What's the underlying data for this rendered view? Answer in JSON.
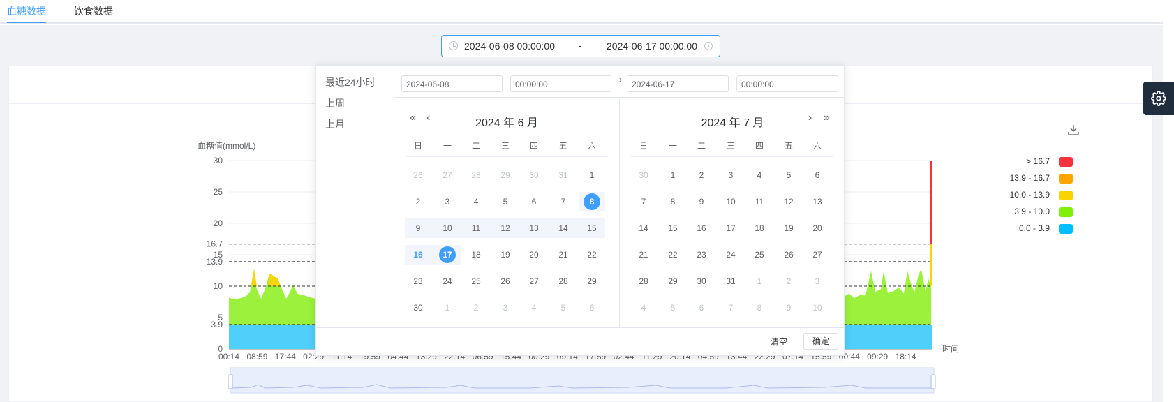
{
  "tabs": [
    {
      "label": "血糖数据",
      "active": true
    },
    {
      "label": "饮食数据",
      "active": false
    }
  ],
  "range_editor": {
    "start": "2024-06-08 00:00:00",
    "separator": "-",
    "end": "2024-06-17 00:00:00"
  },
  "picker": {
    "shortcuts": [
      "最近24小时",
      "上周",
      "上月"
    ],
    "start_date": "2024-06-08",
    "start_time": "00:00:00",
    "end_date": "2024-06-17",
    "end_time": "00:00:00",
    "range_arrow": "›",
    "weekdays": [
      "日",
      "一",
      "二",
      "三",
      "四",
      "五",
      "六"
    ],
    "left_title": "2024 年 6 月",
    "right_title": "2024 年 7 月",
    "left_days": [
      [
        "26",
        "27",
        "28",
        "29",
        "30",
        "31",
        "1"
      ],
      [
        "2",
        "3",
        "4",
        "5",
        "6",
        "7",
        "8"
      ],
      [
        "9",
        "10",
        "11",
        "12",
        "13",
        "14",
        "15"
      ],
      [
        "16",
        "17",
        "18",
        "19",
        "20",
        "21",
        "22"
      ],
      [
        "23",
        "24",
        "25",
        "26",
        "27",
        "28",
        "29"
      ],
      [
        "30",
        "1",
        "2",
        "3",
        "4",
        "5",
        "6"
      ]
    ],
    "right_days": [
      [
        "30",
        "1",
        "2",
        "3",
        "4",
        "5",
        "6"
      ],
      [
        "7",
        "8",
        "9",
        "10",
        "11",
        "12",
        "13"
      ],
      [
        "14",
        "15",
        "16",
        "17",
        "18",
        "19",
        "20"
      ],
      [
        "21",
        "22",
        "23",
        "24",
        "25",
        "26",
        "27"
      ],
      [
        "28",
        "29",
        "30",
        "31",
        "1",
        "2",
        "3"
      ],
      [
        "4",
        "5",
        "6",
        "7",
        "8",
        "9",
        "10"
      ]
    ],
    "clear_label": "清空",
    "ok_label": "确定"
  },
  "chart_data": {
    "type": "area",
    "ylabel": "血糖值(mmol/L)",
    "xlabel": "时间",
    "yticks": [
      "30",
      "25",
      "20",
      "16.7",
      "15",
      "13.9",
      "10",
      "5",
      "3.9",
      "0"
    ],
    "ylim": [
      0,
      30
    ],
    "xticks": [
      "00:14",
      "08:59",
      "17:44",
      "02:29",
      "11:14",
      "19:59",
      "04:44",
      "13:29",
      "22:14",
      "06:59",
      "15:44",
      "00:29",
      "09:14",
      "17:59",
      "02:44",
      "11:29",
      "20:14",
      "04:59",
      "13:44",
      "22:29",
      "07:14",
      "15:59",
      "00:44",
      "09:29",
      "18:14"
    ],
    "reference_lines": [
      16.7,
      13.9,
      10,
      3.9
    ],
    "legend": [
      {
        "label": "> 16.7",
        "color": "#f5333f"
      },
      {
        "label": "13.9 - 16.7",
        "color": "#ffa500"
      },
      {
        "label": "10.0 - 13.9",
        "color": "#fad400"
      },
      {
        "label": "3.9 - 10.0",
        "color": "#7ef00a"
      },
      {
        "label": "0.0 - 3.9",
        "color": "#00bfff"
      }
    ]
  }
}
